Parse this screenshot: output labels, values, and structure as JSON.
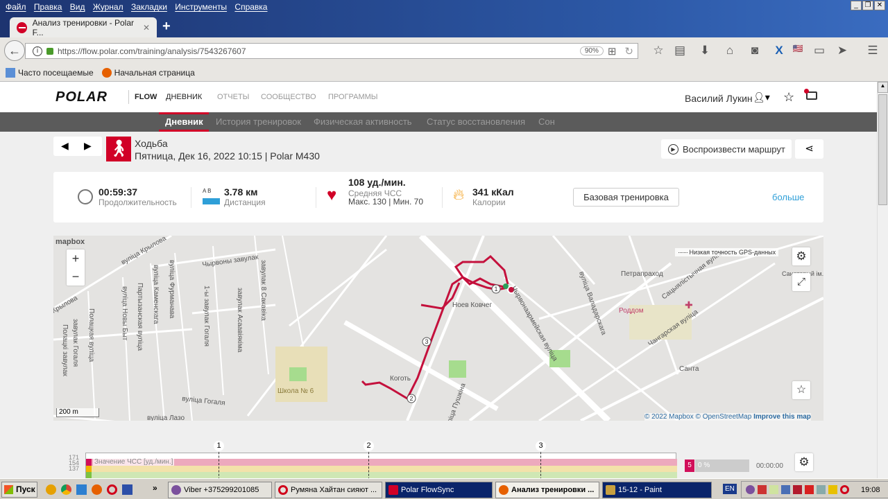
{
  "browser": {
    "menu": [
      "Файл",
      "Правка",
      "Вид",
      "Журнал",
      "Закладки",
      "Инструменты",
      "Справка"
    ],
    "tab_title": "Анализ тренировки - Polar F...",
    "url": "https://flow.polar.com/training/analysis/7543267607",
    "zoom": "90%",
    "bookmarks": [
      "Часто посещаемые",
      "Начальная страница"
    ]
  },
  "polar": {
    "logo": "POLAR",
    "flow": "FLOW",
    "nav": [
      "ДНЕВНИК",
      "ОТЧЕТЫ",
      "СООБЩЕСТВО",
      "ПРОГРАММЫ"
    ],
    "user": "Василий Лукин",
    "subnav": [
      "Дневник",
      "История тренировок",
      "Физическая активность",
      "Статус восстановления",
      "Сон"
    ]
  },
  "training": {
    "sport": "Ходьба",
    "date_device": "Пятница, Дек 16, 2022 10:15 | Polar M430",
    "replay": "Воспроизвести маршрут",
    "duration": "00:59:37",
    "duration_label": "Продолжительность",
    "distance_ab": "A  B",
    "distance": "3.78 км",
    "distance_label": "Дистанция",
    "hr": "108 уд./мин.",
    "hr_label": "Средняя ЧСС",
    "hr_minmax": "Макс. 130  |  Мин. 70",
    "calories": "341 кКал",
    "calories_label": "Калории",
    "benefit": "Базовая тренировка",
    "more": "больше"
  },
  "map": {
    "mapbox": "mapbox",
    "zoom_in": "+",
    "zoom_out": "−",
    "gps_legend": "Низкая точность GPS-данных",
    "scale": "200 m",
    "attribution_1": "© 2022 Mapbox ©",
    "attribution_2": "OpenStreetMap",
    "attribution_3": "Improve this map",
    "labels": [
      "вуліца Крылова",
      "Крылова",
      "Чырвоны завулак",
      "вуліца Фурманава",
      "вуліца Каменскага",
      "Партызанская вуліца",
      "вуліца Новы Быт",
      "Полацкая вуліца",
      "завулак Гогаля",
      "Полацкі завулак",
      "1-ы завулак Гогаля",
      "завулак Асаавіякіма",
      "завулак 8 Сакавіка",
      "вуліца Гогаля",
      "вуліца Лазо",
      "Школа № 6",
      "Коготь",
      "Ноев Ковчег",
      "вуліца Пушкіна",
      "Чырвонаармейская вуліца",
      "вуліца Валадарскага",
      "Петрапраход",
      "Роддом",
      "Сацыялістычная вуліца",
      "Чангарская вуліца",
      "Санта",
      "Санаторый ім. Бялініна"
    ],
    "laps": [
      "1",
      "2",
      "3"
    ]
  },
  "chart": {
    "y_ticks": [
      "171",
      "154",
      "137"
    ],
    "series_label": "Значение ЧСС [уд./мин.]",
    "laps": [
      "1",
      "2",
      "3"
    ],
    "zone": "5",
    "zone_pct": "0 %",
    "zone_time": "00:00:00"
  },
  "taskbar": {
    "start": "Пуск",
    "tasks": [
      "Viber +375299201085",
      "Румяна Хайтан сияют ...",
      "Polar FlowSync",
      "Анализ тренировки ...",
      "15-12 - Paint"
    ],
    "lang": "EN",
    "clock": "19:08"
  }
}
